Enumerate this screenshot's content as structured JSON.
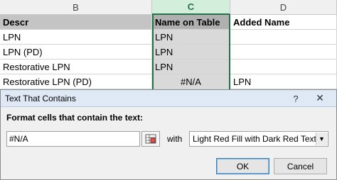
{
  "sheet": {
    "columns": [
      "B",
      "C",
      "D"
    ],
    "rows": [
      {
        "descr": "Descr",
        "name_on_table": "Name on Table",
        "added_name": "Added Name"
      },
      {
        "descr": "LPN",
        "name_on_table": "LPN",
        "added_name": ""
      },
      {
        "descr": "LPN (PD)",
        "name_on_table": "LPN",
        "added_name": ""
      },
      {
        "descr": "Restorative LPN",
        "name_on_table": "LPN",
        "added_name": ""
      },
      {
        "descr": "Restorative LPN (PD)",
        "name_on_table": "#N/A",
        "added_name": "LPN"
      },
      {
        "descr": "",
        "name_on_table": "",
        "added_name": ""
      }
    ]
  },
  "dialog": {
    "title": "Text That Contains",
    "help": "?",
    "close": "✕",
    "prompt": "Format cells that contain the text:",
    "input_value": "#N/A",
    "with_label": "with",
    "format_value": "Light Red Fill with Dark Red Text",
    "ok_label": "OK",
    "cancel_label": "Cancel"
  }
}
